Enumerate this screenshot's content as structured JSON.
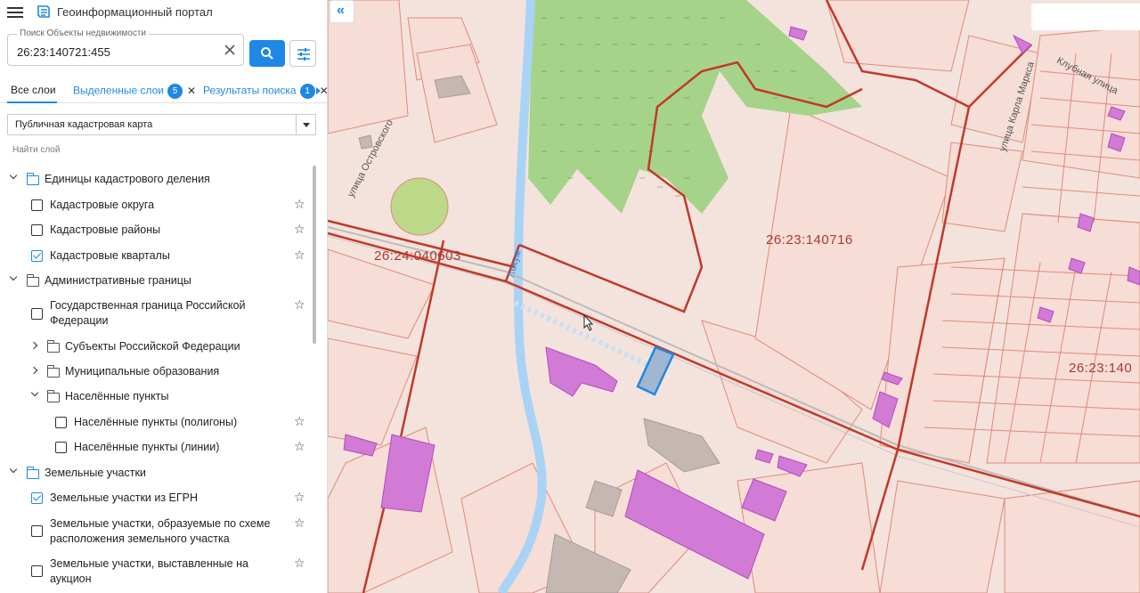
{
  "app": {
    "title": "Геоинформационный портал"
  },
  "search": {
    "label": "Поиск Объекты недвижимости",
    "value": "26:23:140721:455"
  },
  "tabs": [
    {
      "label": "Все слои",
      "badge": ""
    },
    {
      "label": "Выделенные слои",
      "badge": "5"
    },
    {
      "label": "Результаты поиска",
      "badge": "1"
    }
  ],
  "layer_select": {
    "selected": "Публичная кадастровая карта"
  },
  "find_layer": {
    "placeholder": "Найти слой"
  },
  "tree": {
    "g1": {
      "label": "Единицы кадастрового деления"
    },
    "g1_items": [
      {
        "label": "Кадастровые округа",
        "checked": false
      },
      {
        "label": "Кадастровые районы",
        "checked": false
      },
      {
        "label": "Кадастровые кварталы",
        "checked": true
      }
    ],
    "g2": {
      "label": "Административные границы"
    },
    "g2_item": {
      "label": "Государственная граница Российской Федерации"
    },
    "g2_sub1": {
      "label": "Субъекты Российской Федерации"
    },
    "g2_sub2": {
      "label": "Муниципальные образования"
    },
    "g2_sub3": {
      "label": "Населённые пункты"
    },
    "g2_sub3_items": [
      {
        "label": "Населённые пункты (полигоны)"
      },
      {
        "label": "Населённые пункты (линии)"
      }
    ],
    "g3": {
      "label": "Земельные участки"
    },
    "g3_items": [
      {
        "label": "Земельные участки из ЕГРН",
        "checked": true
      },
      {
        "label": "Земельные участки, образуемые по схеме расположения земельного участка",
        "checked": false
      },
      {
        "label": "Земельные участки, выставленные на аукцион",
        "checked": false
      }
    ]
  },
  "map": {
    "quarter_labels": [
      "26:24:040603",
      "26:23:140716",
      "26:23:140"
    ],
    "streets": [
      "улица Островского",
      "Лекум",
      "улица Карла Маркса",
      "Клубная улица"
    ]
  },
  "colors": {
    "accent": "#1e88e5",
    "quarter_border": "#c0392b",
    "building": "#d17ad6",
    "forest": "#a6d38a",
    "river": "#a9d3f5"
  }
}
